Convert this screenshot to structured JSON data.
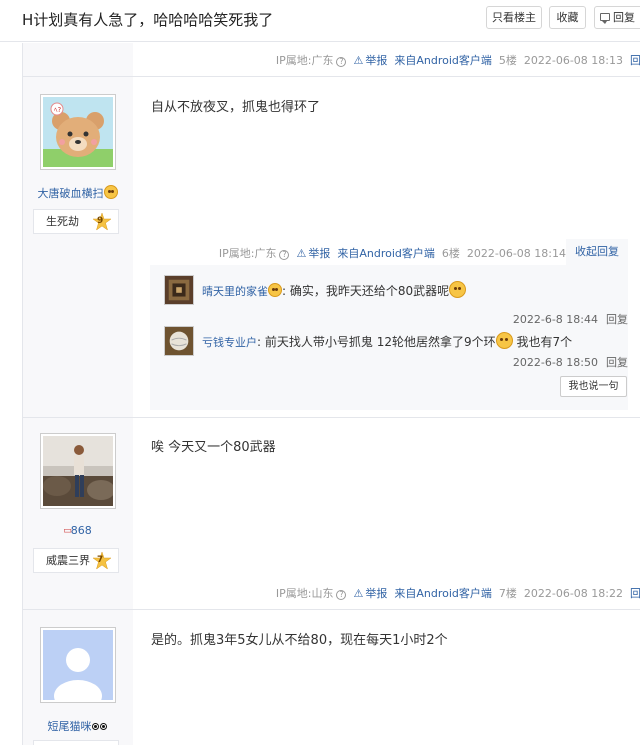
{
  "header": {
    "title": "H计划真有人急了，哈哈哈哈笑死我了",
    "buttons": [
      "只看楼主",
      "收藏",
      "回复"
    ]
  },
  "colors": {
    "link": "#3163a5",
    "meta": "#999999",
    "divider": "#e4e6eb",
    "left_bg": "#f8f8fa",
    "badge": "#f5c242"
  },
  "posts": [
    {
      "tail": {
        "ip": "IP属地:广东",
        "report": "举报",
        "client": "来自Android客户端",
        "floor": "5楼",
        "time": "2022-06-08 18:13",
        "reply": "回复"
      }
    },
    {
      "user": {
        "name": "大唐破血横扫",
        "level_title": "生死劫",
        "level": "9",
        "avatar_icon": "bear-avatar"
      },
      "content": "自从不放夜叉，抓鬼也得环了",
      "tail": {
        "ip": "IP属地:广东",
        "report": "举报",
        "client": "来自Android客户端",
        "floor": "6楼",
        "time": "2022-06-08 18:14",
        "reply": "收起回复"
      },
      "replies": [
        {
          "user": "晴天里的家雀",
          "sep": ":",
          "text": "确实，我昨天还给个80武器呢",
          "time": "2022-6-8 18:44",
          "reply": "回复"
        },
        {
          "user": "亏钱专业户",
          "sep": ":",
          "text": "前天找人带小号抓鬼 12轮他居然拿了9个环",
          "text2": "我也有7个",
          "time": "2022-6-8 18:50",
          "reply": "回复"
        }
      ],
      "say_button": "我也说一句"
    },
    {
      "user": {
        "name": "868",
        "level_title": "威震三界",
        "level": "7",
        "avatar_icon": "photo-avatar"
      },
      "content": "唉 今天又一个80武器",
      "tail": {
        "ip": "IP属地:山东",
        "report": "举报",
        "client": "来自Android客户端",
        "floor": "7楼",
        "time": "2022-06-08 18:22",
        "reply": "回复"
      }
    },
    {
      "user": {
        "name": "短尾猫咪",
        "avatar_icon": "default-avatar"
      },
      "content": "是的。抓鬼3年5女儿从不给80，现在每天1小时2个"
    }
  ]
}
